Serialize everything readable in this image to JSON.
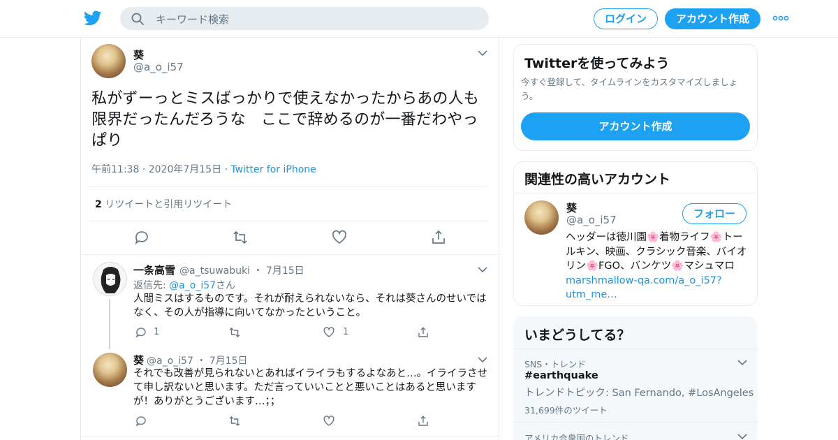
{
  "header": {
    "search_placeholder": "キーワード検索",
    "login_label": "ログイン",
    "signup_label": "アカウント作成"
  },
  "tweet": {
    "name": "葵",
    "handle": "@a_o_i57",
    "text": "私がずーっとミスばっかりで使えなかったからあの人も限界だったんだろうな　ここで辞めるのが一番だわやっぱり",
    "time": "午前11:38",
    "date": "2020年7月15日",
    "client": "Twitter for iPhone",
    "retweet_count": "2",
    "retweet_label": "リツイートと引用リツイート"
  },
  "replies": [
    {
      "name": "一条高雪",
      "handle": "@a_tsuwabuki",
      "date": "7月15日",
      "reply_to_prefix": "返信先:",
      "reply_to_handle": "@a_o_i57",
      "reply_to_suffix": "さん",
      "text": "人間ミスはするものです。それが耐えられないなら、それは葵さんのせいではなく、その人が指導に向いてなかったということ。",
      "reply_count": "1",
      "like_count": "1"
    },
    {
      "name": "葵",
      "handle": "@a_o_i57",
      "date": "7月15日",
      "text": "それでも改善が見られないとあればイライラもするよなあと…。イライラさせて申し訳ないと思います。ただ言っていいことと悪いことはあると思いますが！ありがとうございます…；；"
    }
  ],
  "signup_card": {
    "title": "Twitterを使ってみよう",
    "subtitle": "今すぐ登録して、タイムラインをカスタマイズしましょう。",
    "button": "アカウント作成"
  },
  "related_card": {
    "title": "関連性の高いアカウント",
    "name": "葵",
    "handle": "@a_o_i57",
    "follow_label": "フォロー",
    "bio_text": "ヘッダーは徳川園🌸着物ライフ🌸トールキン、映画、クラシック音楽、バイオリン🌸FGO、バンケツ🌸マシュマロ",
    "bio_link": "marshmallow-qa.com/a_o_i57?utm_me…"
  },
  "trends_card": {
    "title": "いまどうしてる？",
    "trends": [
      {
        "category": "SNS・トレンド",
        "name": "#earthquake",
        "desc": "トレンドトピック: San Fernando, #LosAngeles",
        "count": "31,699件のツイート"
      },
      {
        "category": "アメリカ合衆国のトレンド"
      }
    ]
  },
  "colors": {
    "brand": "#1da1f2",
    "link": "#1b95e0",
    "secondary_text": "#657786",
    "border": "#e6ecf0"
  }
}
